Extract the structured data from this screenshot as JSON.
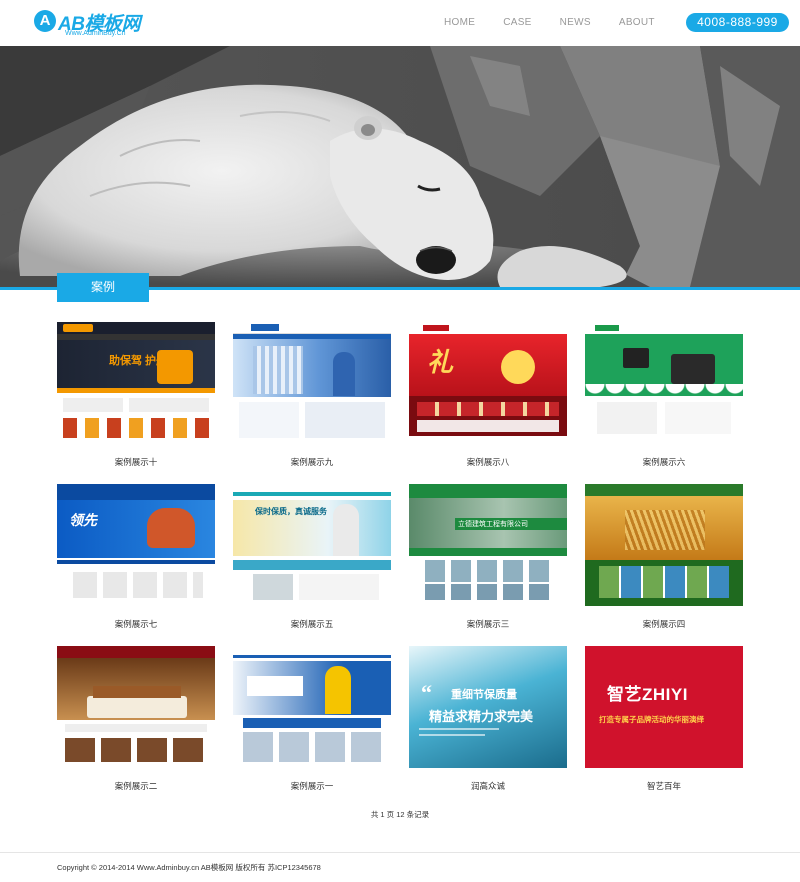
{
  "header": {
    "logo_mark": "A",
    "logo_text": "AB模板网",
    "logo_sub": "Www.AdminBuy.Cn",
    "nav": [
      {
        "label": "HOME"
      },
      {
        "label": "CASE"
      },
      {
        "label": "NEWS"
      },
      {
        "label": "ABOUT"
      }
    ],
    "phone": "4008-888-999"
  },
  "section": {
    "title": "案例"
  },
  "cases": [
    {
      "label": "案例展示十",
      "theme": "dark-orange"
    },
    {
      "label": "案例展示九",
      "theme": "blue-corporate"
    },
    {
      "label": "案例展示八",
      "theme": "red-festive"
    },
    {
      "label": "案例展示六",
      "theme": "green-printer"
    },
    {
      "label": "案例展示七",
      "theme": "blue-boiler"
    },
    {
      "label": "案例展示五",
      "theme": "teal-education"
    },
    {
      "label": "案例展示三",
      "theme": "green-building"
    },
    {
      "label": "案例展示四",
      "theme": "wheat-field"
    },
    {
      "label": "案例展示二",
      "theme": "hotel-room"
    },
    {
      "label": "案例展示一",
      "theme": "blue-worker"
    },
    {
      "label": "润高众诚",
      "theme": "sky-quality"
    },
    {
      "label": "智艺百年",
      "theme": "red-zhiyi"
    }
  ],
  "thumb_text": {
    "c10_banner": "助保驾 护航",
    "c7_banner": "领先",
    "c5_banner": "保时保质，真诚服务",
    "c3_banner": "立德建筑工程有限公司",
    "c11_line1": "重细节保质量",
    "c11_line2": "精益求精力求完美",
    "c12_big": "智艺ZHIYI",
    "c12_sub": "打造专属子品牌活动的华丽演绎",
    "c8_banner": "礼",
    "brand_small": "AB模板网"
  },
  "pager": "共 1 页 12 条记录",
  "footer": "Copyright © 2014-2014 Www.Adminbuy.cn  AB模板网 版权所有    苏ICP12345678",
  "colors": {
    "accent": "#1aa9e6"
  }
}
